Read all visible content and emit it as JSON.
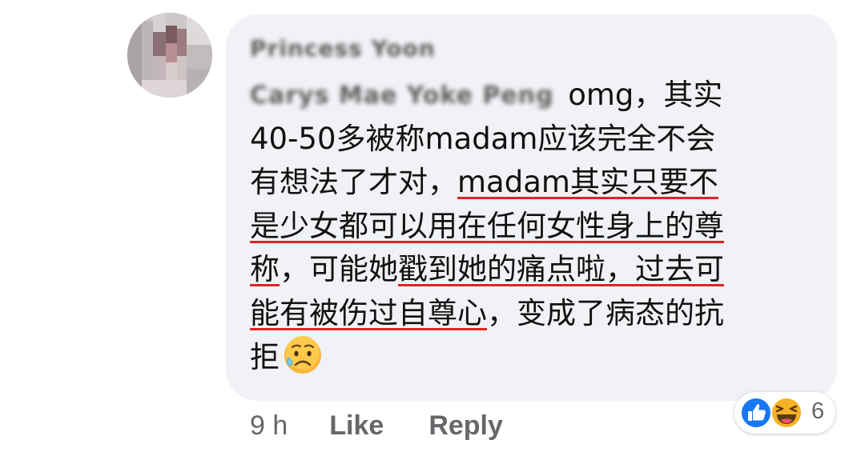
{
  "comment": {
    "author": "Princess Yoon",
    "mention": "Carys Mae Yoke Peng",
    "lines": [
      [
        {
          "text": " omg，其实",
          "underline": false
        }
      ],
      [
        {
          "text": "40-50多被称madam应该完全不会",
          "underline": false
        }
      ],
      [
        {
          "text": "有想法了才对，",
          "underline": false
        },
        {
          "text": "madam其实只要不",
          "underline": true
        }
      ],
      [
        {
          "text": "是少女都可以用在任何女性身上的尊",
          "underline": true
        }
      ],
      [
        {
          "text": "称",
          "underline": true
        },
        {
          "text": "，可能她",
          "underline": false
        },
        {
          "text": "戳到她的痛点啦，过去可",
          "underline": true
        }
      ],
      [
        {
          "text": "能有被伤过自尊心",
          "underline": true
        },
        {
          "text": "，变成了病态的抗",
          "underline": false
        }
      ],
      [
        {
          "text": "拒",
          "underline": false
        }
      ]
    ],
    "end_emoji": "sad-but-relieved-face"
  },
  "actions": {
    "time": "9 h",
    "like_label": "Like",
    "reply_label": "Reply"
  },
  "reactions": {
    "types": [
      "like",
      "haha"
    ],
    "count": "6"
  },
  "colors": {
    "bubble": "#f0f2f5",
    "text": "#111111",
    "meta": "#65676b",
    "underline": "#e02424",
    "like_blue": "#1877f2"
  }
}
